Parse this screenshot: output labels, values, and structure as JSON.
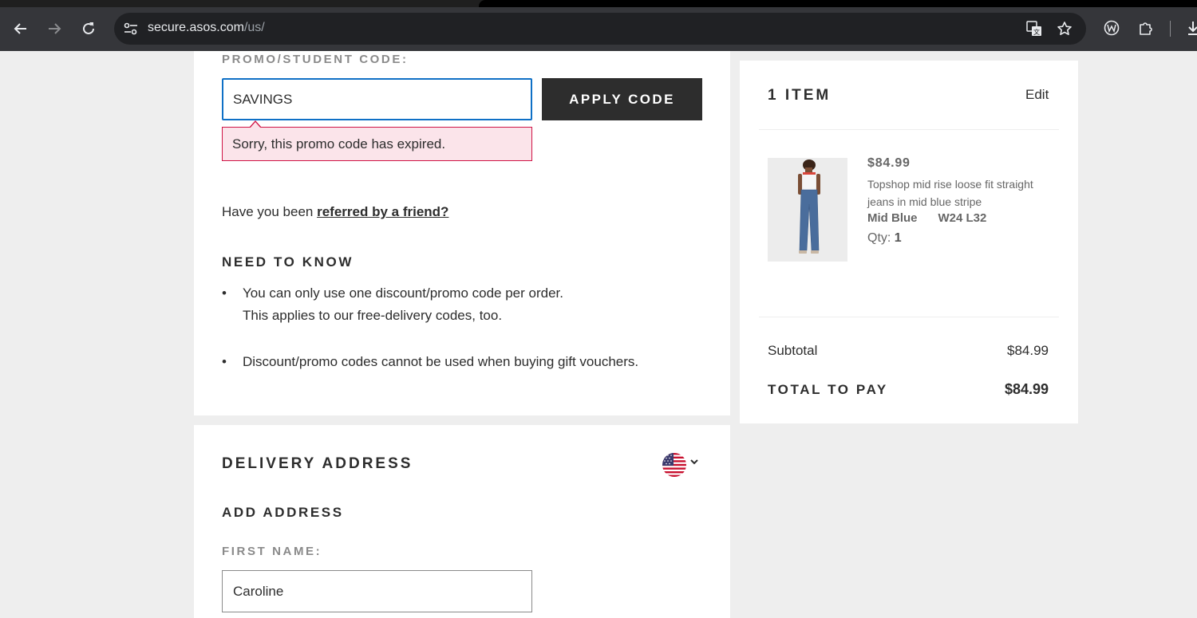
{
  "browser": {
    "url_domain": "secure.asos.com",
    "url_path": "/us/",
    "icons": {
      "back": "arrow-left-icon",
      "forward": "arrow-right-icon",
      "reload": "reload-icon",
      "site_info": "site-info-icon",
      "translate": "translate-icon",
      "bookmark": "star-icon",
      "extension_w": "w-extension-icon",
      "extensions": "puzzle-icon",
      "download": "download-icon"
    }
  },
  "promo": {
    "label": "PROMO/STUDENT CODE:",
    "input_value": "SAVINGS",
    "apply_label": "APPLY CODE",
    "error_message": "Sorry, this promo code has expired.",
    "referral_prefix": "Have you been ",
    "referral_link": "referred by a friend?"
  },
  "need_to_know": {
    "title": "NEED TO KNOW",
    "items": [
      {
        "line1": "You can only use one discount/promo code per order.",
        "line2": "This applies to our free-delivery codes, too."
      },
      {
        "line1": "Discount/promo codes cannot be used when buying gift vouchers.",
        "line2": ""
      }
    ]
  },
  "delivery": {
    "title": "DELIVERY ADDRESS",
    "add_address": "ADD ADDRESS",
    "first_name_label": "FIRST NAME:",
    "first_name_value": "Caroline",
    "country_flag": "us-flag-icon"
  },
  "bag": {
    "title": "1 ITEM",
    "edit_label": "Edit",
    "item": {
      "price": "$84.99",
      "name": "Topshop mid rise loose fit straight jeans in mid blue stripe",
      "color": "Mid Blue",
      "size": "W24 L32",
      "qty_label": "Qty:",
      "qty": "1"
    },
    "subtotal_label": "Subtotal",
    "subtotal_value": "$84.99",
    "total_label": "TOTAL TO PAY",
    "total_value": "$84.99"
  },
  "colors": {
    "focus_blue": "#0f70c6",
    "error_red": "#d01345",
    "error_bg": "#fbe4ea",
    "button_dark": "#2d2d2d"
  }
}
